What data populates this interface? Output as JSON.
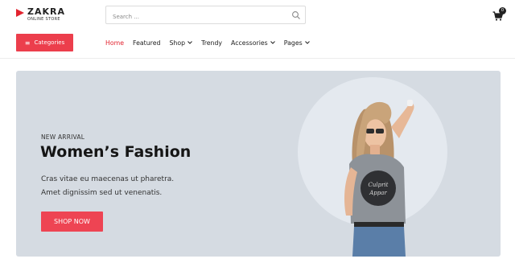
{
  "brand": {
    "name": "ZAKRA",
    "tagline": "ONLINE STORE",
    "accent": "#e2232f"
  },
  "search": {
    "placeholder": "Search ...",
    "icon": "search-icon"
  },
  "cart": {
    "icon": "cart-icon",
    "count": "0"
  },
  "categories": {
    "label": "Categories",
    "icon": "menu-icon",
    "color": "#ec3e4c"
  },
  "nav": {
    "items": [
      {
        "label": "Home",
        "active": true,
        "dropdown": false
      },
      {
        "label": "Featured",
        "active": false,
        "dropdown": false
      },
      {
        "label": "Shop",
        "active": false,
        "dropdown": true
      },
      {
        "label": "Trendy",
        "active": false,
        "dropdown": false
      },
      {
        "label": "Accessories",
        "active": false,
        "dropdown": true
      },
      {
        "label": "Pages",
        "active": false,
        "dropdown": true
      }
    ]
  },
  "hero": {
    "eyebrow": "NEW ARRIVAL",
    "title": "Women’s Fashion",
    "description_line1": "Cras vitae eu maecenas ut pharetra.",
    "description_line2": "Amet dignissim sed ut venenatis.",
    "cta_label": "SHOP NOW",
    "cta_color": "#ee4453",
    "background": "#d5dbe2"
  }
}
